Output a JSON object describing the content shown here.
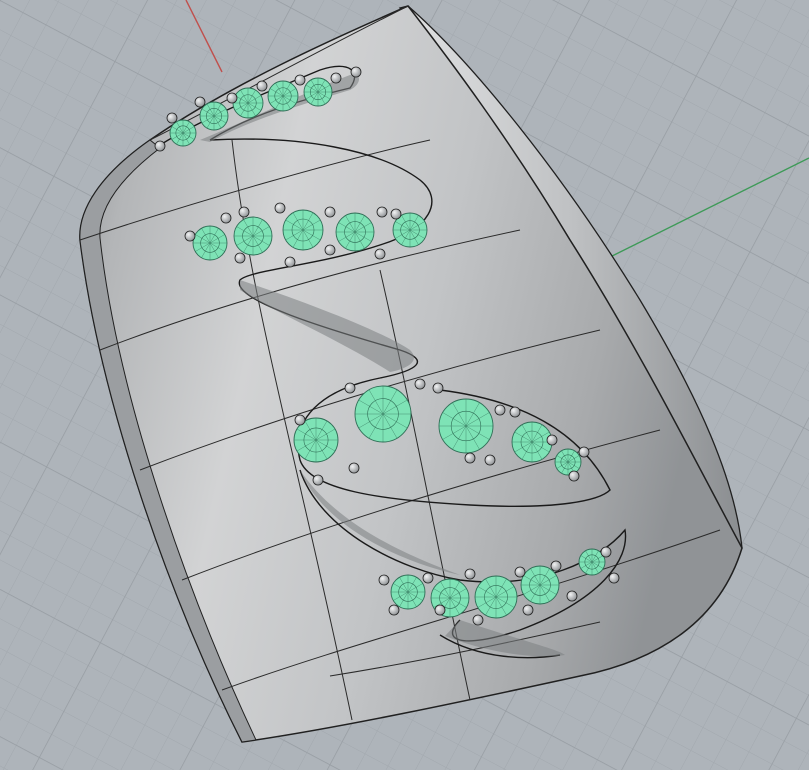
{
  "viewport": {
    "background": "#aeb4ba",
    "grid_minor": "#a2a8ae",
    "grid_major": "#979da3",
    "x_axis_color": "#c0504d",
    "y_axis_color": "#3d9a57"
  },
  "model": {
    "object": "ring-band",
    "display_mode": "shaded",
    "band_color": "#c4c6c8",
    "edge_color": "#202020",
    "gem_color": "#7ee3b6",
    "gem_wire_color": "#2f6e56",
    "prong_color": "#d8dadc",
    "gem_count_visible": 20
  }
}
